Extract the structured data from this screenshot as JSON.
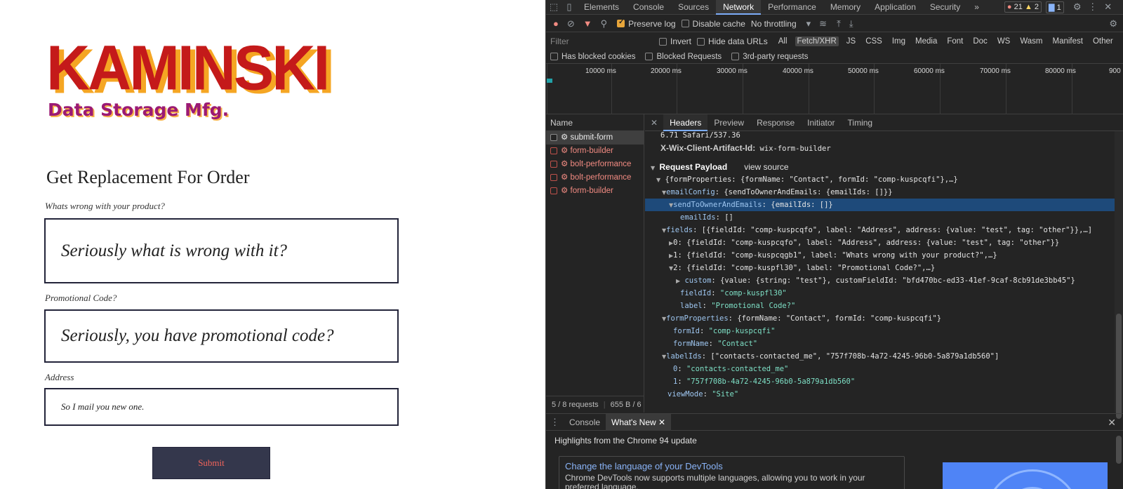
{
  "site": {
    "logo_main": "KAMINSKI",
    "logo_sub": "Data Storage Mfg.",
    "form_title": "Get Replacement For Order",
    "fields": [
      {
        "label": "Whats wrong with your product?",
        "value": "Seriously what is wrong with it?"
      },
      {
        "label": "Promotional Code?",
        "value": "Seriously, you have promotional code?"
      },
      {
        "label": "Address",
        "value": "So I mail you new one."
      }
    ],
    "submit_label": "Submit"
  },
  "devtools": {
    "tabs": [
      "Elements",
      "Console",
      "Sources",
      "Network",
      "Performance",
      "Memory",
      "Application",
      "Security"
    ],
    "active_tab": "Network",
    "more_tabs": "»",
    "badges": {
      "errors": "21",
      "warnings": "2",
      "messages": "1"
    },
    "toolbar": {
      "preserve_log": "Preserve log",
      "disable_cache": "Disable cache",
      "throttling": "No throttling"
    },
    "filter": {
      "placeholder": "Filter",
      "invert": "Invert",
      "hide_data_urls": "Hide data URLs",
      "types": [
        "All",
        "Fetch/XHR",
        "JS",
        "CSS",
        "Img",
        "Media",
        "Font",
        "Doc",
        "WS",
        "Wasm",
        "Manifest",
        "Other"
      ],
      "active_type": "Fetch/XHR",
      "has_blocked_cookies": "Has blocked cookies",
      "blocked_requests": "Blocked Requests",
      "third_party": "3rd-party requests"
    },
    "timeline_ticks": [
      "10000 ms",
      "20000 ms",
      "30000 ms",
      "40000 ms",
      "50000 ms",
      "60000 ms",
      "70000 ms",
      "80000 ms",
      "900"
    ],
    "requests": {
      "header": "Name",
      "items": [
        {
          "name": "⚙ submit-form",
          "selected": true,
          "error": false
        },
        {
          "name": "⚙ form-builder",
          "selected": false,
          "error": true
        },
        {
          "name": "⚙ bolt-performance",
          "selected": false,
          "error": true
        },
        {
          "name": "⚙ bolt-performance",
          "selected": false,
          "error": true
        },
        {
          "name": "⚙ form-builder",
          "selected": false,
          "error": true
        }
      ],
      "status": "5 / 8 requests",
      "size": "655 B / 6"
    },
    "detail_tabs": [
      "Headers",
      "Preview",
      "Response",
      "Initiator",
      "Timing"
    ],
    "detail_active": "Headers",
    "headers_partial": "6.71 Safari/537.36",
    "client_artifact_key": "X-Wix-Client-Artifact-Id:",
    "client_artifact_value": "wix-form-builder",
    "payload_title": "Request Payload",
    "view_source": "view source",
    "payload_lines": [
      {
        "key": "",
        "val": "{formProperties: {formName: \"Contact\", formId: \"comp-kuspcqfi\"},…}"
      },
      {
        "key": "emailConfig",
        "val": "{sendToOwnerAndEmails: {emailIds: []}}"
      },
      {
        "key": "sendToOwnerAndEmails",
        "val": "{emailIds: []}"
      },
      {
        "key": "emailIds",
        "val": "[]"
      },
      {
        "key": "fields",
        "val": "[{fieldId: \"comp-kuspcqfo\", label: \"Address\", address: {value: \"test\", tag: \"other\"}},…]"
      },
      {
        "key": "0",
        "val": "{fieldId: \"comp-kuspcqfo\", label: \"Address\", address: {value: \"test\", tag: \"other\"}}"
      },
      {
        "key": "1",
        "val": "{fieldId: \"comp-kuspcqgb1\", label: \"Whats wrong with your product?\",…}"
      },
      {
        "key": "2",
        "val": "{fieldId: \"comp-kuspfl30\", label: \"Promotional Code?\",…}"
      },
      {
        "key": "custom",
        "val": "{value: {string: \"test\"}, customFieldId: \"bfd470bc-ed33-41ef-9caf-8cb91de3bb45\"}"
      },
      {
        "key": "fieldId",
        "val": "\"comp-kuspfl30\""
      },
      {
        "key": "label",
        "val": "\"Promotional Code?\""
      },
      {
        "key": "formProperties",
        "val": "{formName: \"Contact\", formId: \"comp-kuspcqfi\"}"
      },
      {
        "key": "formId",
        "val": "\"comp-kuspcqfi\""
      },
      {
        "key": "formName",
        "val": "\"Contact\""
      },
      {
        "key": "labelIds",
        "val": "[\"contacts-contacted_me\", \"757f708b-4a72-4245-96b0-5a879a1db560\"]"
      },
      {
        "key": "0",
        "val": "\"contacts-contacted_me\""
      },
      {
        "key": "1",
        "val": "\"757f708b-4a72-4245-96b0-5a879a1db560\""
      },
      {
        "key": "viewMode",
        "val": "\"Site\""
      }
    ],
    "drawer": {
      "tabs": [
        "Console",
        "What's New"
      ],
      "active": "What's New",
      "title": "Highlights from the Chrome 94 update",
      "card_title": "Change the language of your DevTools",
      "card_body": "Chrome DevTools now supports multiple languages, allowing you to work in your preferred language."
    }
  },
  "colors": {
    "logo_red": "#c41a1a",
    "logo_orange": "#f5a623",
    "logo_purple": "#9b1a74",
    "button_bg": "#34374c",
    "button_text": "#f2645a",
    "devtools_bg": "#242424",
    "selection_blue": "#1e4a7a"
  }
}
